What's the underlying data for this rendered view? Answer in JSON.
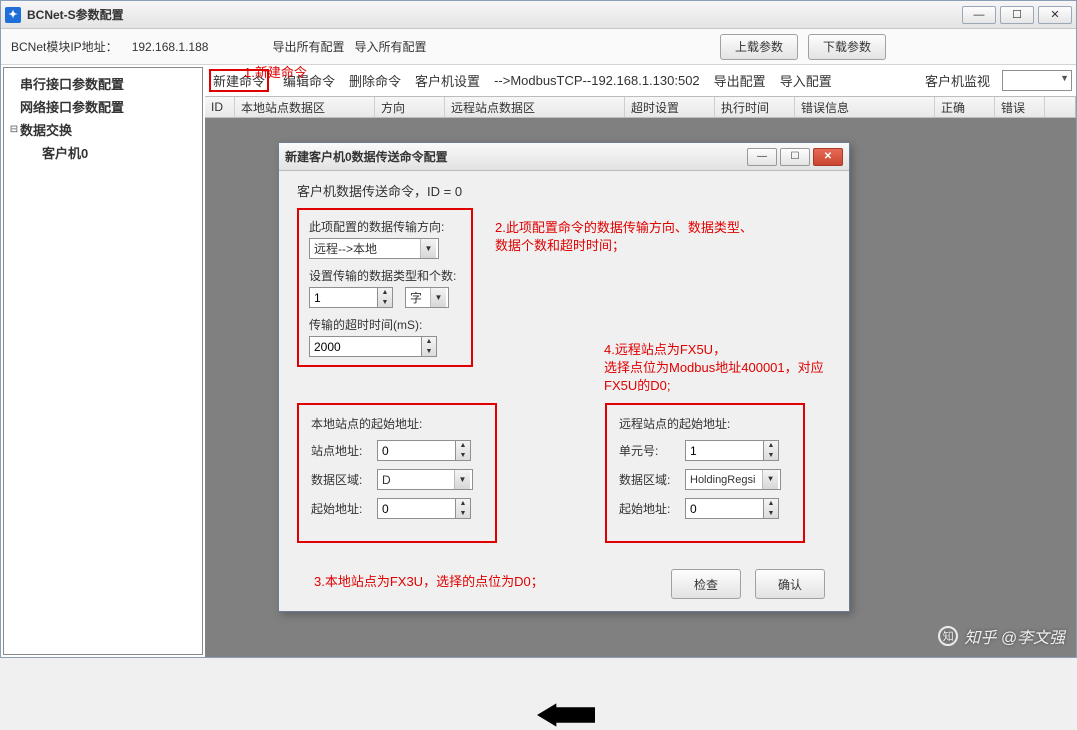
{
  "window": {
    "title": "BCNet-S参数配置",
    "min": "—",
    "max": "☐",
    "close": "✕"
  },
  "toolbar": {
    "ip_label": "BCNet模块IP地址：",
    "ip_value": "192.168.1.188",
    "export_all": "导出所有配置",
    "import_all": "导入所有配置",
    "upload": "上载参数",
    "download": "下载参数"
  },
  "annotations": {
    "a1": "1.新建命令",
    "a2": "2.此项配置命令的数据传输方向、数据类型、数据个数和超时时间；",
    "a3": "3.本地站点为FX3U，选择的点位为D0；",
    "a4": "4.远程站点为FX5U，\n选择点位为Modbus地址400001，对应FX5U的D0;"
  },
  "tree": {
    "i1": "串行接口参数配置",
    "i2": "网络接口参数配置",
    "i3": "数据交换",
    "i4": "客户机0"
  },
  "cmdbar": {
    "newcmd": "新建命令",
    "editcmd": "编辑命令",
    "delcmd": "删除命令",
    "clientcfg": "客户机设置",
    "conn": "-->ModbusTCP--192.168.1.130:502",
    "exportcfg": "导出配置",
    "importcfg": "导入配置",
    "monitor": "客户机监视"
  },
  "cols": {
    "id": "ID",
    "a": "本地站点数据区",
    "b": "方向",
    "c": "远程站点数据区",
    "d": "超时设置",
    "e": "执行时间",
    "f": "错误信息",
    "g": "正确",
    "h": "错误"
  },
  "dialog": {
    "title": "新建客户机0数据传送命令配置",
    "caption": "客户机数据传送命令，ID = 0",
    "dir_label": "此项配置的数据传输方向:",
    "dir_value": "远程-->本地",
    "type_label": "设置传输的数据类型和个数:",
    "count_value": "1",
    "type_value": "字",
    "timeout_label": "传输的超时时间(mS):",
    "timeout_value": "2000",
    "local_hdr": "本地站点的起始地址:",
    "remote_hdr": "远程站点的起始地址:",
    "site_addr": "站点地址:",
    "unit_no": "单元号:",
    "area": "数据区域:",
    "start": "起始地址:",
    "local_site_val": "0",
    "local_area_val": "D",
    "local_start_val": "0",
    "remote_unit_val": "1",
    "remote_area_val": "HoldingRegsi",
    "remote_start_val": "0",
    "check": "检查",
    "ok": "确认"
  },
  "watermark": "知乎 @李文强"
}
